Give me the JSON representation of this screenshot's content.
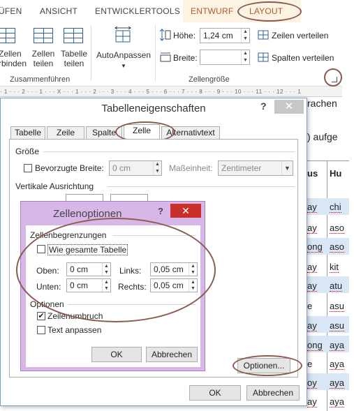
{
  "ribbon": {
    "tabs": [
      "ÜFEN",
      "ANSICHT",
      "ENTWICKLERTOOLS",
      "ENTWURF",
      "LAYOUT"
    ],
    "zusammenfuehren": {
      "zellen_verbinden": [
        "Zellen",
        "rbinden"
      ],
      "zellen_teilen": [
        "Zellen",
        "teilen"
      ],
      "tabelle_teilen": [
        "Tabelle",
        "teilen"
      ],
      "group_label": "Zusammenführen"
    },
    "autoanpassen": "AutoAnpassen",
    "zellengroesse": {
      "hoehe_label": "Höhe:",
      "hoehe_value": "1,24 cm",
      "breite_label": "Breite:",
      "breite_value": "",
      "zeilen_verteilen": "Zeilen verteilen",
      "spalten_verteilen": "Spalten verteilen",
      "group_label": "Zellengröße"
    },
    "ruler": "· 1 · · · 2 · · · 1 · · · X · · · 1 · · · 2 · · · 3 · · · 4 · · · 5 · · · 6 · · · 7 · · · 8 · · · 9 · · · 10 · · · 11 · · · 12 · · · 1"
  },
  "document": {
    "text1": "rachen",
    "text2": ") aufge",
    "table_headers": [
      "us",
      "Hu"
    ],
    "col1": [
      "ay",
      "ay",
      "ong",
      "ay",
      "ay",
      "e",
      "ay",
      "ong",
      "e",
      "oy",
      "ay"
    ],
    "col2": [
      "chi",
      "aso",
      "aso",
      "kit",
      "atu",
      "asu",
      "asu",
      "aya",
      "aya",
      "aya",
      "aya"
    ]
  },
  "dialog": {
    "title": "Tabelleneigenschaften",
    "help": "?",
    "close": "✕",
    "tabs": [
      "Tabelle",
      "Zeile",
      "Spalte",
      "Zelle",
      "Alternativtext"
    ],
    "active_tab": "Zelle",
    "groesse_label": "Größe",
    "bevorzugte_breite_label": "Bevorzugte Breite:",
    "bevorzugte_breite_value": "0 cm",
    "masseinheit_label": "Maßeinheit:",
    "masseinheit_value": "Zentimeter",
    "vertikale_ausrichtung_label": "Vertikale Ausrichtung",
    "optionen_button": "Optionen...",
    "ok_button": "OK",
    "abbrechen_button": "Abbrechen"
  },
  "zellenoptionen": {
    "title": "Zellenoptionen",
    "help": "?",
    "close": "✕",
    "zellenbegrenzungen_label": "Zellenbegrenzungen",
    "wie_gesamte_tabelle": "Wie gesamte Tabelle",
    "wie_gesamte_tabelle_checked": false,
    "oben_label": "Oben:",
    "oben_value": "0 cm",
    "unten_label": "Unten:",
    "unten_value": "0 cm",
    "links_label": "Links:",
    "links_value": "0,05 cm",
    "rechts_label": "Rechts:",
    "rechts_value": "0,05 cm",
    "optionen_label": "Optionen",
    "zeilenumbruch": "Zeilenumbruch",
    "zeilenumbruch_checked": true,
    "text_anpassen": "Text anpassen",
    "text_anpassen_checked": false,
    "ok_button": "OK",
    "abbrechen_button": "Abbrechen"
  },
  "colors": {
    "accent_blue": "#2d5f9a",
    "contextual_tab": "#b7572c",
    "highlight_oval": "#8c5a4f",
    "zellenoptionen_frame": "#d7b7e8",
    "close_red": "#c9302c"
  }
}
